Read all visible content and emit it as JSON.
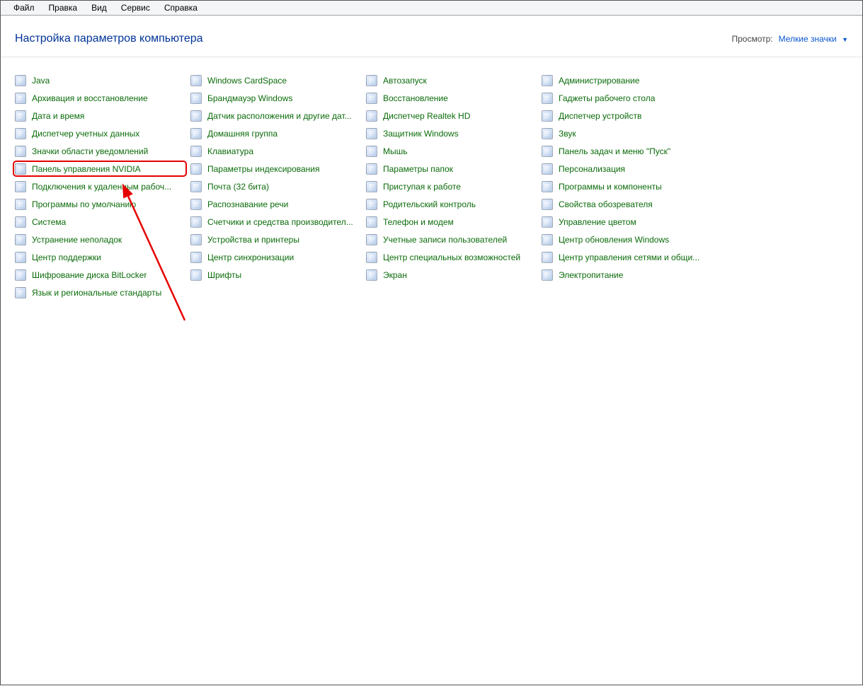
{
  "menu": [
    "Файл",
    "Правка",
    "Вид",
    "Сервис",
    "Справка"
  ],
  "header": {
    "title": "Настройка параметров компьютера",
    "view_label": "Просмотр:",
    "view_value": "Мелкие значки"
  },
  "highlighted_item": "Панель управления NVIDIA",
  "columns": [
    [
      "Java",
      "Архивация и восстановление",
      "Дата и время",
      "Диспетчер учетных данных",
      "Значки области уведомлений",
      "Панель управления NVIDIA",
      "Подключения к удаленным рабоч...",
      "Программы по умолчанию",
      "Система",
      "Устранение неполадок",
      "Центр поддержки",
      "Шифрование диска BitLocker",
      "Язык и региональные стандарты"
    ],
    [
      "Windows CardSpace",
      "Брандмауэр Windows",
      "Датчик расположения и другие дат...",
      "Домашняя группа",
      "Клавиатура",
      "Параметры индексирования",
      "Почта (32 бита)",
      "Распознавание речи",
      "Счетчики и средства производител...",
      "Устройства и принтеры",
      "Центр синхронизации",
      "Шрифты"
    ],
    [
      "Автозапуск",
      "Восстановление",
      "Диспетчер Realtek HD",
      "Защитник Windows",
      "Мышь",
      "Параметры папок",
      "Приступая к работе",
      "Родительский контроль",
      "Телефон и модем",
      "Учетные записи пользователей",
      "Центр специальных возможностей",
      "Экран"
    ],
    [
      "Администрирование",
      "Гаджеты рабочего стола",
      "Диспетчер устройств",
      "Звук",
      "Панель задач и меню \"Пуск\"",
      "Персонализация",
      "Программы и компоненты",
      "Свойства обозревателя",
      "Управление цветом",
      "Центр обновления Windows",
      "Центр управления сетями и общи...",
      "Электропитание"
    ]
  ]
}
